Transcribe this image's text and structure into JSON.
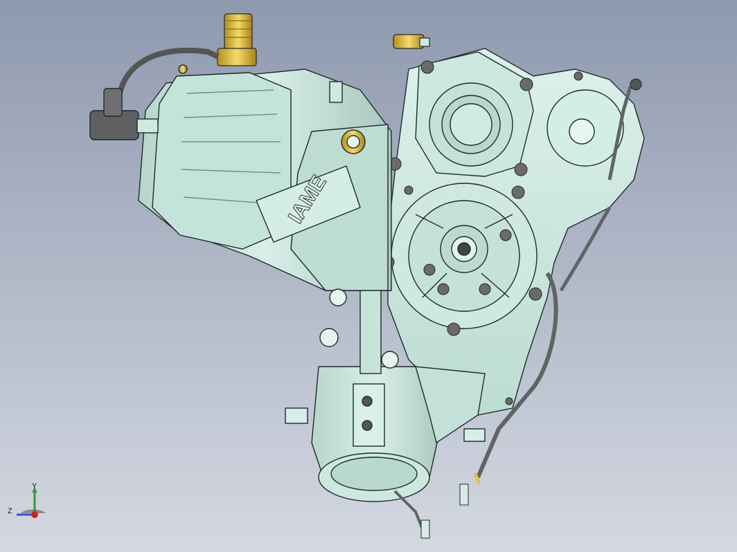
{
  "model": {
    "brand_mark": "IAME",
    "colors": {
      "body": "#c9e7de",
      "body_shade": "#9fbfb6",
      "edge": "#1f2a28",
      "brass": "#e3c14a",
      "bolt": "#6a6a6a",
      "background_top": "#8f99ae",
      "background_bottom": "#d4d8e1"
    }
  },
  "triad": {
    "y_label": "Y",
    "z_label": "Z"
  }
}
